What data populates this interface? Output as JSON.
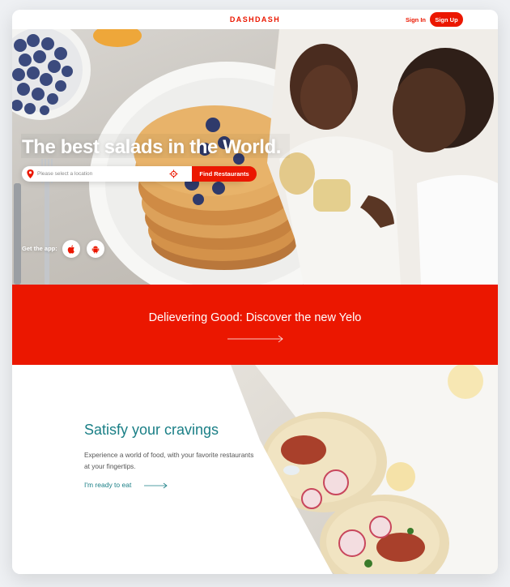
{
  "nav": {
    "logo": "DASHDASH",
    "sign_in": "Sign In",
    "sign_up": "Sign Up"
  },
  "hero": {
    "title": "The best salads in the World.",
    "search": {
      "placeholder": "Please select a location",
      "button": "Find Restaurants"
    },
    "get_app": "Get the app:",
    "store_icons": [
      "apple-icon",
      "android-icon"
    ]
  },
  "banner": {
    "text": "Delievering Good: Discover the new Yelo"
  },
  "cravings": {
    "title": "Satisfy your cravings",
    "text": "Experience a world of food, with your favorite restaurants at your fingertips.",
    "link": "I'm ready to eat"
  },
  "colors": {
    "brand_red": "#eb1700",
    "teal": "#1a7f86",
    "background": "#eef0f3"
  }
}
